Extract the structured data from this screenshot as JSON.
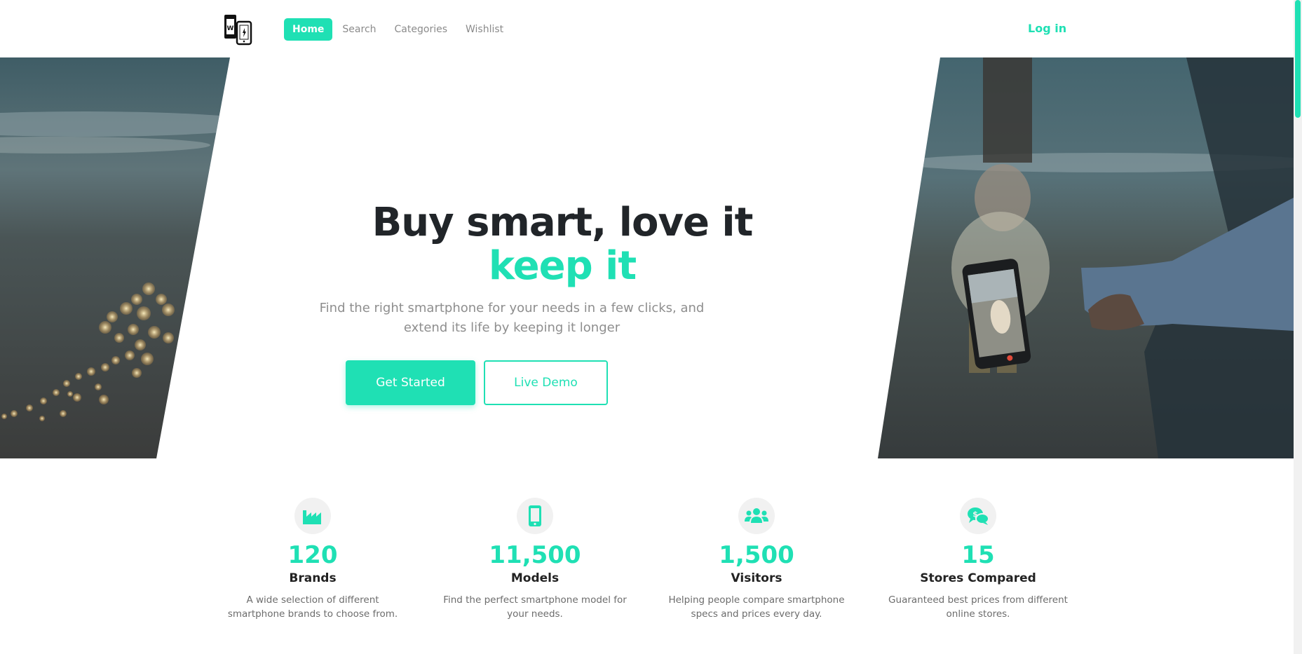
{
  "nav": {
    "items": [
      {
        "label": "Home",
        "active": true
      },
      {
        "label": "Search",
        "active": false
      },
      {
        "label": "Categories",
        "active": false
      },
      {
        "label": "Wishlist",
        "active": false
      }
    ],
    "login": "Log in"
  },
  "hero": {
    "title_line1": "Buy smart, love it",
    "title_line2": "keep it",
    "subtitle": "Find the right smartphone for your needs in a few clicks, and extend its life by keeping it longer",
    "primary_button": "Get Started",
    "secondary_button": "Live Demo"
  },
  "stats": [
    {
      "icon": "factory-icon",
      "number": "120",
      "label": "Brands",
      "desc": "A wide selection of different smartphone brands to choose from."
    },
    {
      "icon": "mobile-phone-icon",
      "number": "11,500",
      "label": "Models",
      "desc": "Find the perfect smartphone model for your needs."
    },
    {
      "icon": "users-icon",
      "number": "1,500",
      "label": "Visitors",
      "desc": "Helping people compare smartphone specs and prices every day."
    },
    {
      "icon": "price-comments-icon",
      "number": "15",
      "label": "Stores Compared",
      "desc": "Guaranteed best prices from different online stores."
    }
  ],
  "colors": {
    "accent": "#1fe0b4",
    "text_dark": "#212529",
    "text_muted": "#8e8e8e"
  }
}
